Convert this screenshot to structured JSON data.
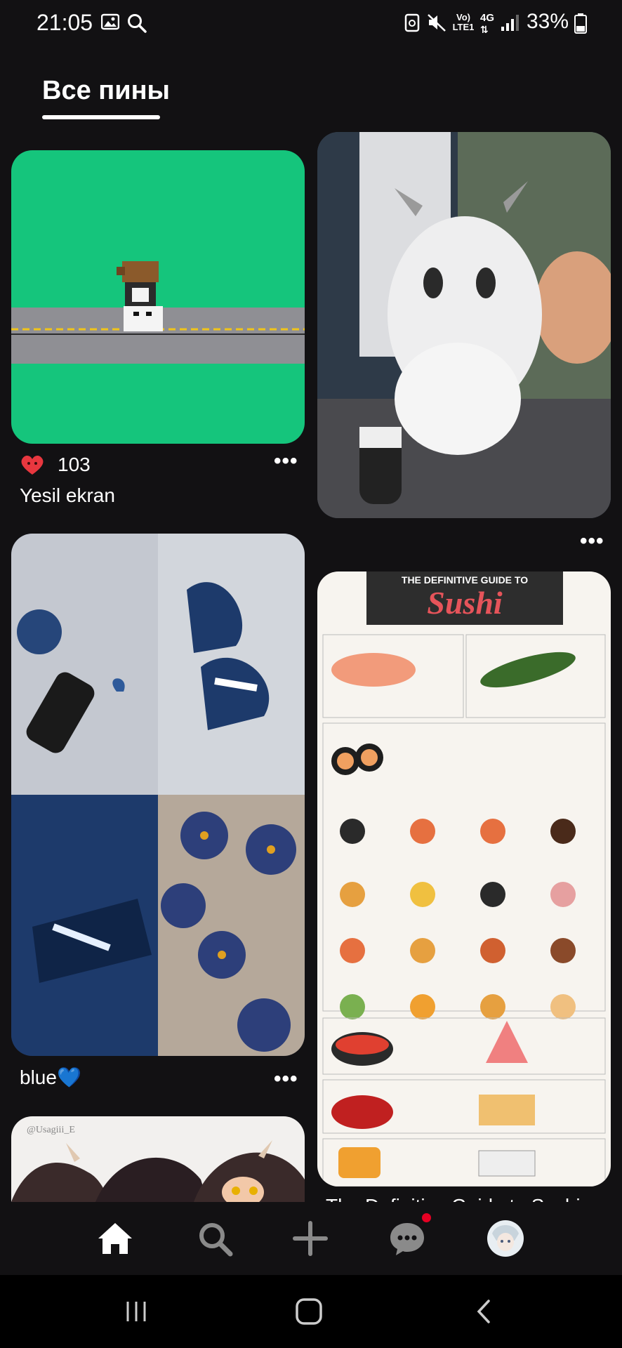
{
  "status_bar": {
    "time": "21:05",
    "network": "Vo) LTE1",
    "signal_label": "4G",
    "battery": "33%"
  },
  "header": {
    "tab_label": "Все пины"
  },
  "pins": [
    {
      "title": "Yesil ekran",
      "likes": "103"
    },
    {
      "title": ""
    },
    {
      "title": "blue💙"
    },
    {
      "title": "The Definitive Guide to Sushi",
      "poster_heading": "THE DEFINITIVE GUIDE TO",
      "poster_title": "Sushi"
    },
    {
      "title": "",
      "watermark": "@Usagiii_E"
    }
  ],
  "colors": {
    "background": "#121113",
    "green_screen": "#15c57c",
    "accent_red": "#e60023"
  },
  "icons": {
    "home": "home-icon",
    "search": "search-icon",
    "create": "plus-icon",
    "messages": "chat-icon",
    "profile": "avatar"
  }
}
